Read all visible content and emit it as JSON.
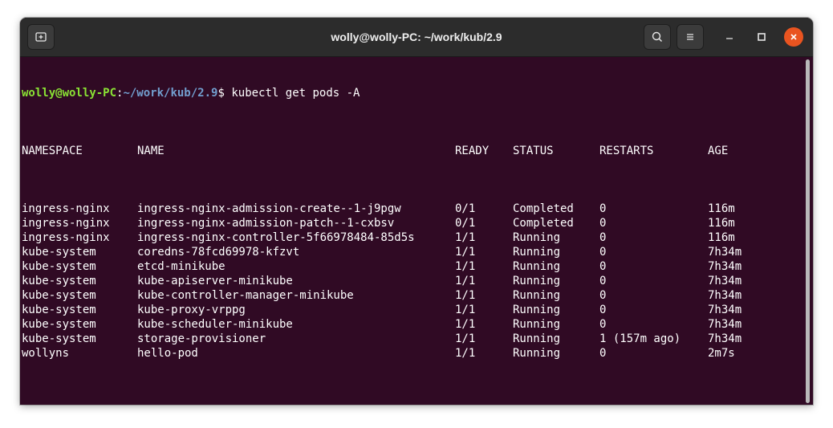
{
  "window": {
    "title": "wolly@wolly-PC: ~/work/kub/2.9"
  },
  "prompt": {
    "user_host": "wolly@wolly-PC",
    "colon": ":",
    "path": "~/work/kub/2.9",
    "symbol": "$"
  },
  "command": " kubectl get pods -A",
  "table": {
    "headers": [
      "NAMESPACE",
      "NAME",
      "READY",
      "STATUS",
      "RESTARTS",
      "AGE"
    ],
    "rows": [
      [
        "ingress-nginx",
        "ingress-nginx-admission-create--1-j9pgw",
        "0/1",
        "Completed",
        "0",
        "116m"
      ],
      [
        "ingress-nginx",
        "ingress-nginx-admission-patch--1-cxbsv",
        "0/1",
        "Completed",
        "0",
        "116m"
      ],
      [
        "ingress-nginx",
        "ingress-nginx-controller-5f66978484-85d5s",
        "1/1",
        "Running",
        "0",
        "116m"
      ],
      [
        "kube-system",
        "coredns-78fcd69978-kfzvt",
        "1/1",
        "Running",
        "0",
        "7h34m"
      ],
      [
        "kube-system",
        "etcd-minikube",
        "1/1",
        "Running",
        "0",
        "7h34m"
      ],
      [
        "kube-system",
        "kube-apiserver-minikube",
        "1/1",
        "Running",
        "0",
        "7h34m"
      ],
      [
        "kube-system",
        "kube-controller-manager-minikube",
        "1/1",
        "Running",
        "0",
        "7h34m"
      ],
      [
        "kube-system",
        "kube-proxy-vrppg",
        "1/1",
        "Running",
        "0",
        "7h34m"
      ],
      [
        "kube-system",
        "kube-scheduler-minikube",
        "1/1",
        "Running",
        "0",
        "7h34m"
      ],
      [
        "kube-system",
        "storage-provisioner",
        "1/1",
        "Running",
        "1 (157m ago)",
        "7h34m"
      ],
      [
        "wollyns",
        "hello-pod",
        "1/1",
        "Running",
        "0",
        "2m7s"
      ]
    ]
  },
  "icons": {
    "new_tab": "new-tab-icon",
    "search": "search-icon",
    "menu": "hamburger-menu-icon",
    "minimize": "minimize-icon",
    "maximize": "maximize-icon",
    "close": "close-icon"
  },
  "colors": {
    "terminal_bg": "#300a24",
    "prompt_user": "#8ae234",
    "prompt_path": "#729fcf",
    "close_button": "#e95420",
    "titlebar": "#2c2c2c"
  }
}
